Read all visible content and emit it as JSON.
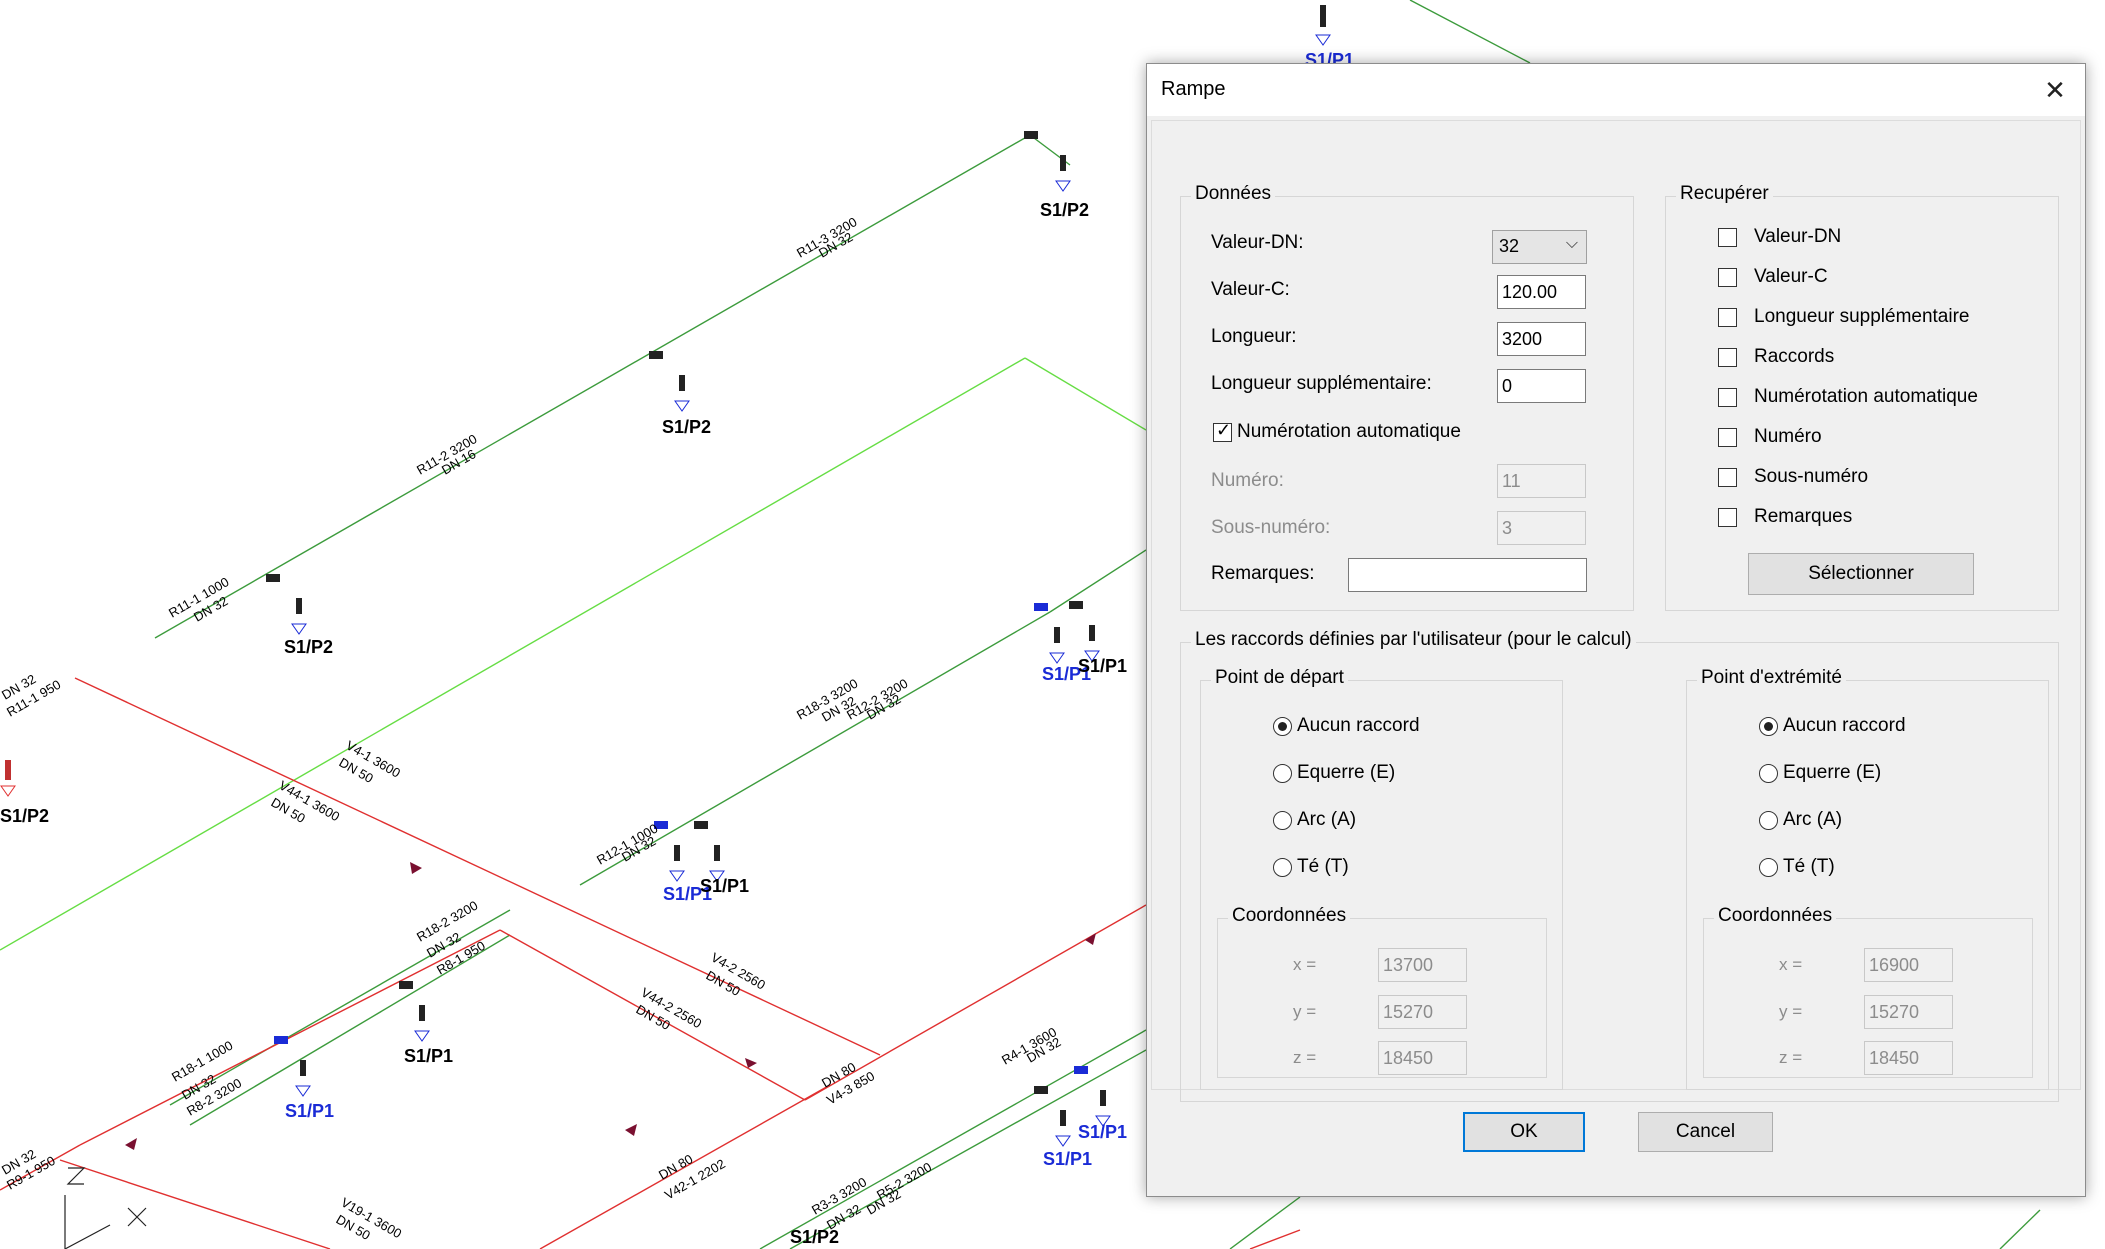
{
  "drawing": {
    "tags": [
      "S1/P2",
      "S1/P2",
      "S1/P2",
      "S1/P2",
      "S1/P1",
      "S1/P1",
      "S1/P1",
      "S1/P1",
      "S1/P1",
      "S1/P1",
      "S1/P1",
      "S1/P1",
      "S1/P2",
      "S1/P1",
      "S1/P1"
    ],
    "pipe_labels": [
      "R11-3 3200",
      "DN 32",
      "R11-2 3200",
      "DN 16",
      "R11-1 1000",
      "DN 32",
      "R18-3 3200",
      "DN 32",
      "R12-2 3200",
      "DN 32",
      "R12-1 1000",
      "DN 32",
      "V4-1 3600",
      "DN 50",
      "V44-1 3600",
      "DN 50",
      "R18-2 3200",
      "DN 32",
      "R8-1 950",
      "V4-2 2560",
      "DN 50",
      "V44-2 2560",
      "DN 50",
      "R18-1 1000",
      "DN 32",
      "R8-2 3200",
      "DN 80",
      "V4-3 850",
      "R4-1 3600",
      "DN 32",
      "DN 80",
      "V42-1 2202",
      "DN 32",
      "R11-1 950",
      "DN 32",
      "R9-1 950",
      "DN 32",
      "V19-1 3600",
      "DN 50",
      "R3-3 3200",
      "DN 32",
      "DN 32",
      "R5-2 3200"
    ]
  },
  "dialog": {
    "title": "Rampe",
    "close_symbol": "✕",
    "donnees": {
      "title": "Données",
      "dn_label": "Valeur-DN:",
      "dn_value": "32",
      "c_label": "Valeur-C:",
      "c_value": "120.00",
      "longueur_label": "Longueur:",
      "longueur_value": "3200",
      "supp_label": "Longueur supplémentaire:",
      "supp_value": "0",
      "auto_label": "Numérotation automatique",
      "auto_checked": true,
      "numero_label": "Numéro:",
      "numero_value": "11",
      "sous_label": "Sous-numéro:",
      "sous_value": "3",
      "remarques_label": "Remarques:",
      "remarques_value": ""
    },
    "recuperer": {
      "title": "Recupérer",
      "items": [
        "Valeur-DN",
        "Valeur-C",
        "Longueur supplémentaire",
        "Raccords",
        "Numérotation automatique",
        "Numéro",
        "Sous-numéro",
        "Remarques"
      ],
      "select_button": "Sélectionner"
    },
    "raccords": {
      "title": "Les raccords définies par l'utilisateur (pour le calcul)",
      "depart": {
        "title": "Point de départ",
        "options": [
          "Aucun raccord",
          "Equerre (E)",
          "Arc (A)",
          "Té (T)"
        ],
        "selected": 0,
        "coord_title": "Coordonnées",
        "x_label": "x =",
        "x": "13700",
        "y_label": "y =",
        "y": "15270",
        "z_label": "z =",
        "z": "18450"
      },
      "extremite": {
        "title": "Point d'extrémité",
        "options": [
          "Aucun raccord",
          "Equerre (E)",
          "Arc (A)",
          "Té (T)"
        ],
        "selected": 0,
        "coord_title": "Coordonnées",
        "x_label": "x =",
        "x": "16900",
        "y_label": "y =",
        "y": "15270",
        "z_label": "z =",
        "z": "18450"
      }
    },
    "ok_label": "OK",
    "cancel_label": "Cancel",
    "colors": {
      "accent": "#0078d7",
      "pipe_green": "#3c9b3c",
      "pipe_red": "#e03030",
      "tag_blue": "#1a2bd6"
    }
  }
}
